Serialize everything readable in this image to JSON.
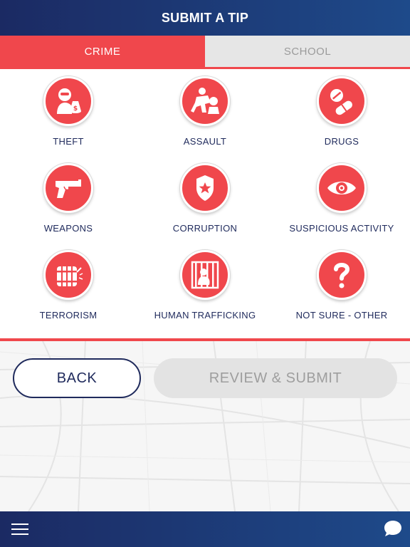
{
  "header": {
    "title": "SUBMIT A TIP"
  },
  "tabs": [
    {
      "label": "CRIME",
      "active": true
    },
    {
      "label": "SCHOOL",
      "active": false
    }
  ],
  "categories": [
    {
      "label": "THEFT",
      "icon": "thief-icon"
    },
    {
      "label": "ASSAULT",
      "icon": "assault-icon"
    },
    {
      "label": "DRUGS",
      "icon": "pills-icon"
    },
    {
      "label": "WEAPONS",
      "icon": "gun-icon"
    },
    {
      "label": "CORRUPTION",
      "icon": "police-badge-icon"
    },
    {
      "label": "SUSPICIOUS ACTIVITY",
      "icon": "eye-icon"
    },
    {
      "label": "TERRORISM",
      "icon": "bomb-icon"
    },
    {
      "label": "HUMAN TRAFFICKING",
      "icon": "jail-icon"
    },
    {
      "label": "NOT SURE - OTHER",
      "icon": "question-icon"
    }
  ],
  "actions": {
    "back_label": "BACK",
    "submit_label": "REVIEW & SUBMIT"
  },
  "footer": {
    "menu_icon": "hamburger-menu-icon",
    "chat_icon": "chat-bubble-icon"
  },
  "colors": {
    "accent": "#f0474c",
    "navy": "#1f2a5c",
    "header": "#1b2a63"
  }
}
